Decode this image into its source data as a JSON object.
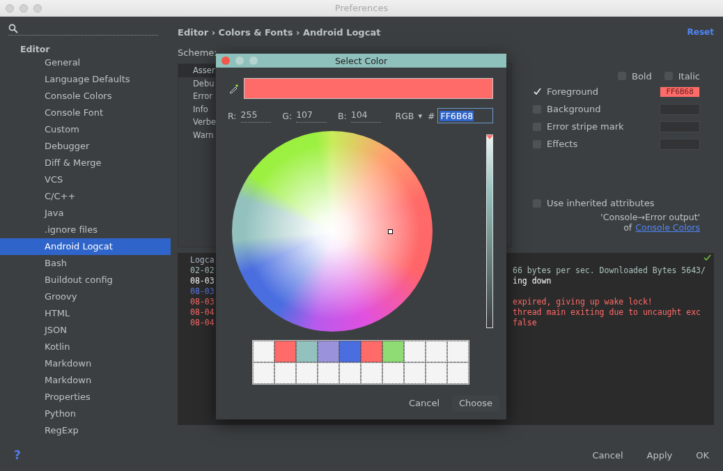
{
  "window": {
    "title": "Preferences"
  },
  "sidebar": {
    "heading": "Editor",
    "items": [
      {
        "label": "General",
        "selected": false
      },
      {
        "label": "Language Defaults",
        "selected": false
      },
      {
        "label": "Console Colors",
        "selected": false
      },
      {
        "label": "Console Font",
        "selected": false
      },
      {
        "label": "Custom",
        "selected": false
      },
      {
        "label": "Debugger",
        "selected": false
      },
      {
        "label": "Diff & Merge",
        "selected": false
      },
      {
        "label": "VCS",
        "selected": false
      },
      {
        "label": "C/C++",
        "selected": false
      },
      {
        "label": "Java",
        "selected": false
      },
      {
        "label": ".ignore files",
        "selected": false
      },
      {
        "label": "Android Logcat",
        "selected": true
      },
      {
        "label": "Bash",
        "selected": false
      },
      {
        "label": "Buildout config",
        "selected": false
      },
      {
        "label": "Groovy",
        "selected": false
      },
      {
        "label": "HTML",
        "selected": false
      },
      {
        "label": "JSON",
        "selected": false
      },
      {
        "label": "Kotlin",
        "selected": false
      },
      {
        "label": "Markdown",
        "selected": false
      },
      {
        "label": "Markdown",
        "selected": false
      },
      {
        "label": "Properties",
        "selected": false
      },
      {
        "label": "Python",
        "selected": false
      },
      {
        "label": "RegExp",
        "selected": false
      }
    ]
  },
  "breadcrumb": "Editor › Colors & Fonts › Android Logcat",
  "reset_link": "Reset",
  "scheme_label": "Scheme:",
  "attributes": [
    {
      "label": "Asser",
      "selected": true
    },
    {
      "label": "Debu",
      "selected": false
    },
    {
      "label": "Error",
      "selected": false
    },
    {
      "label": "Info",
      "selected": false
    },
    {
      "label": "Verbe",
      "selected": false
    },
    {
      "label": "Warn",
      "selected": false
    }
  ],
  "font_style": [
    {
      "label": "Bold",
      "checked": false
    },
    {
      "label": "Italic",
      "checked": false
    }
  ],
  "options": [
    {
      "label": "Foreground",
      "checked": true,
      "value": "FF6B68",
      "color": "#ff6b68"
    },
    {
      "label": "Background",
      "checked": false
    },
    {
      "label": "Error stripe mark",
      "checked": false
    },
    {
      "label": "Effects",
      "checked": false
    }
  ],
  "inherit": {
    "label": "Use inherited attributes",
    "checked": false,
    "source": "'Console→Error output'",
    "of": "of",
    "link": "Console Colors"
  },
  "preview": [
    {
      "left": "Logca",
      "color": "#a9b7c6"
    },
    {
      "left": "02-02",
      "right": "66 bytes per sec. Downloaded Bytes 5643/",
      "color": "#a9c2bd"
    },
    {
      "left": "08-03",
      "right": "ing down",
      "color": "#ffffff"
    },
    {
      "left": "08-03",
      "color": "#5a7be6"
    },
    {
      "left": "08-03",
      "right": "expired, giving up wake lock!",
      "color": "#ff6b68"
    },
    {
      "left": "08-04",
      "right": "thread main exiting due to uncaught exc",
      "color": "#ff6b68"
    },
    {
      "left": "08-04",
      "right": "false",
      "color": "#ff6b68"
    }
  ],
  "dialog": {
    "title": "Select Color",
    "r_label": "R:",
    "r": "255",
    "g_label": "G:",
    "g": "107",
    "b_label": "B:",
    "b": "104",
    "mode": "RGB",
    "mode_caret": "▾",
    "hash": "#",
    "hex": {
      "value": "FF6B68",
      "selected": true
    },
    "brightness": {
      "level": 1
    },
    "swatches": [
      {
        "color": "#f4f4f4"
      },
      {
        "color": "#ff6b68"
      },
      {
        "color": "#93c2be"
      },
      {
        "color": "#9a93dc"
      },
      {
        "color": "#4a6ee0"
      },
      {
        "color": "#ff6b68"
      },
      {
        "color": "#8fdc74"
      },
      {
        "color": "#f4f4f4"
      },
      {
        "color": "#f4f4f4"
      },
      {
        "color": "#f4f4f4"
      },
      {
        "color": "#f4f4f4"
      },
      {
        "color": "#f4f4f4"
      },
      {
        "color": "#f4f4f4"
      },
      {
        "color": "#f4f4f4"
      },
      {
        "color": "#f4f4f4"
      },
      {
        "color": "#f4f4f4"
      },
      {
        "color": "#f4f4f4"
      },
      {
        "color": "#f4f4f4"
      },
      {
        "color": "#f4f4f4"
      },
      {
        "color": "#f4f4f4"
      }
    ],
    "buttons": [
      "Cancel",
      "Choose"
    ]
  },
  "help": "?",
  "buttons": [
    "Cancel",
    "Apply",
    "OK"
  ]
}
